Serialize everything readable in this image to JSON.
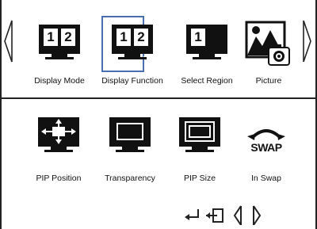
{
  "top_row": {
    "items": [
      {
        "label": "Display Mode",
        "icon": "dual-screen-icon",
        "pane_left": "1",
        "pane_right": "2"
      },
      {
        "label": "Display Function",
        "icon": "dual-screen-icon",
        "pane_left": "1",
        "pane_right": "2",
        "selected": true
      },
      {
        "label": "Select Region",
        "icon": "select-region-icon",
        "pane_left": "1"
      },
      {
        "label": "Picture",
        "icon": "picture-icon"
      }
    ]
  },
  "bottom_row": {
    "items": [
      {
        "label": "PIP Position",
        "icon": "pip-position-icon"
      },
      {
        "label": "Transparency",
        "icon": "transparency-icon"
      },
      {
        "label": "PIP Size",
        "icon": "pip-size-icon"
      },
      {
        "label": "In Swap",
        "icon": "swap-icon",
        "icon_text": "SWAP"
      }
    ]
  },
  "footer": {
    "buttons": [
      "enter-icon",
      "exit-icon",
      "left-arrow-icon",
      "right-arrow-icon"
    ]
  },
  "colors": {
    "selection": "#4a6fb0",
    "icon": "#111111",
    "background": "#ffffff"
  }
}
